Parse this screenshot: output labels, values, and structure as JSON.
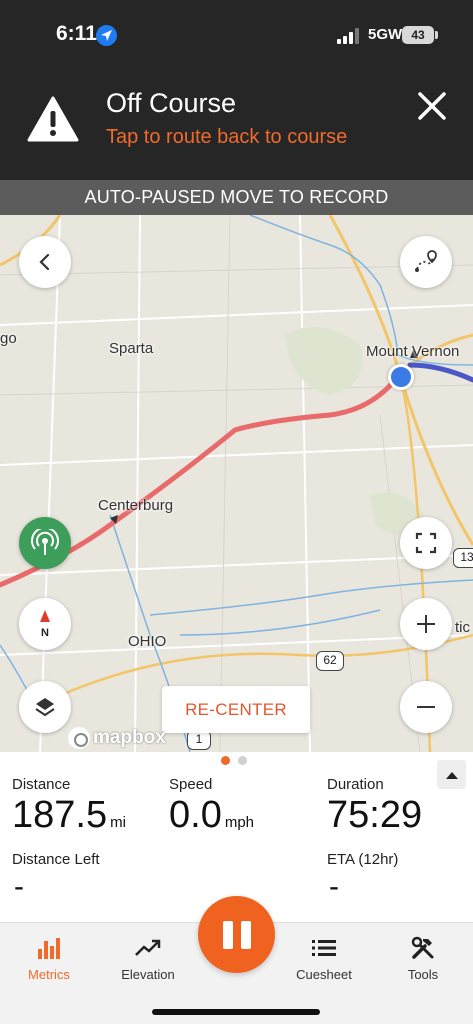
{
  "status_bar": {
    "time": "6:11",
    "network": "5GW",
    "battery": "43"
  },
  "banner": {
    "title": "Off Course",
    "subtitle": "Tap to route back to course",
    "icon": "warning-icon",
    "close_icon": "close-icon"
  },
  "autopause_text": "AUTO-PAUSED MOVE TO RECORD",
  "map": {
    "places": {
      "west_edge": "go",
      "sparta": "Sparta",
      "mount_vernon": "Mount Vernon",
      "centerburg": "Centerburg",
      "ohio": "OHIO",
      "east_edge": "tic"
    },
    "shields": {
      "route_13": "13",
      "route_62": "62",
      "route_1": "1"
    },
    "recenter_label": "RE-CENTER",
    "attribution": "mapbox",
    "colors": {
      "route": "#e86a6a",
      "water": "#7fb3e0",
      "user": "#3a7be6",
      "road_major": "#f2c668"
    }
  },
  "metrics": {
    "distance": {
      "label": "Distance",
      "value": "187.5",
      "unit": "mi"
    },
    "speed": {
      "label": "Speed",
      "value": "0.0",
      "unit": "mph"
    },
    "duration": {
      "label": "Duration",
      "value": "75:29"
    },
    "distance_left": {
      "label": "Distance Left",
      "value": "-"
    },
    "eta": {
      "label": "ETA (12hr)",
      "value": "-"
    }
  },
  "tabs": [
    {
      "label": "Metrics",
      "icon": "bar-chart-icon",
      "active": true
    },
    {
      "label": "Elevation",
      "icon": "trend-icon",
      "active": false
    },
    {
      "label": "Cuesheet",
      "icon": "list-icon",
      "active": false
    },
    {
      "label": "Tools",
      "icon": "tools-icon",
      "active": false
    }
  ],
  "accent_color": "#f06a2a"
}
